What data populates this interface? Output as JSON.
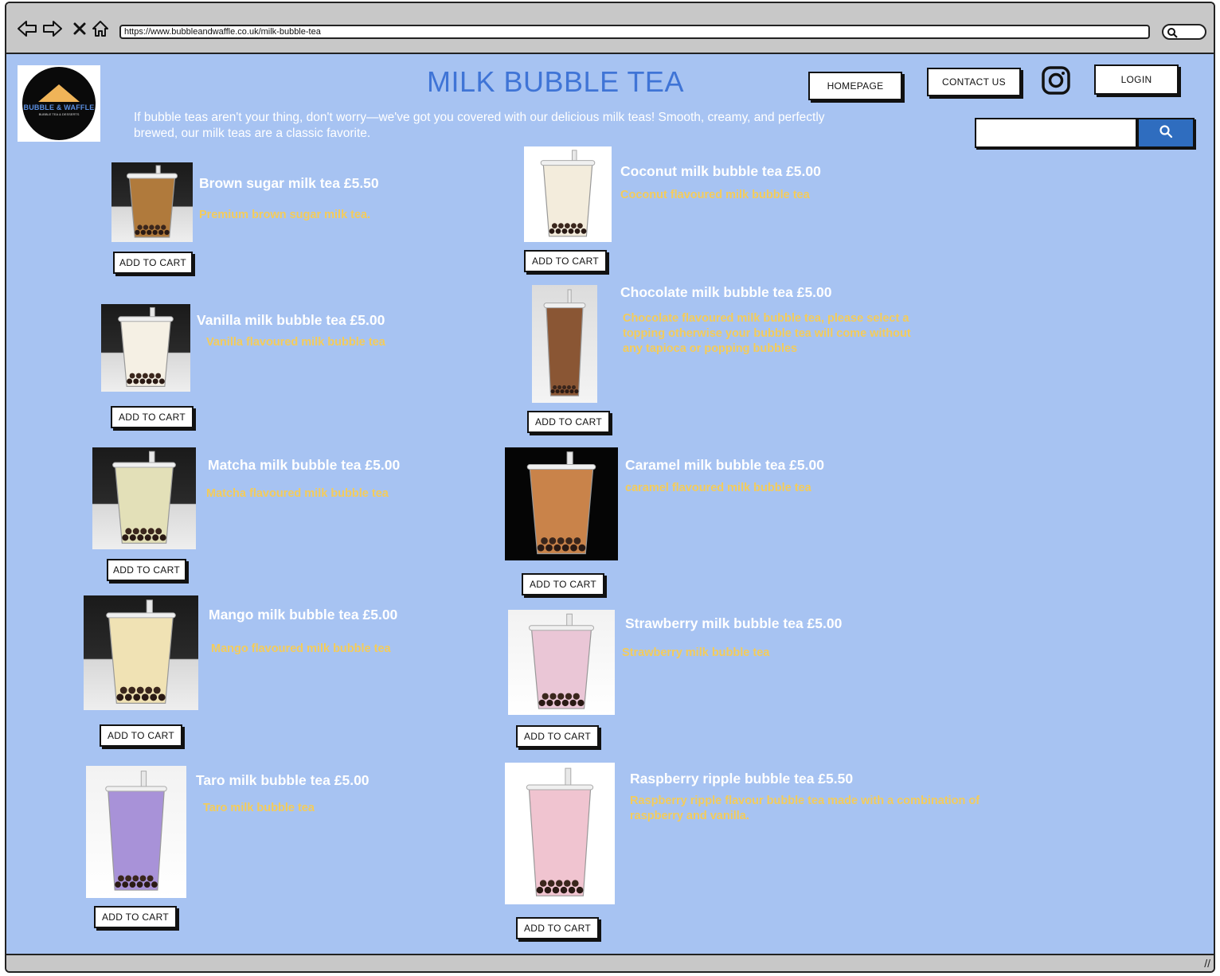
{
  "browser": {
    "url": "https://www.bubbleandwaffle.co.uk/milk-bubble-tea"
  },
  "header": {
    "title": "MILK BUBBLE TEA",
    "intro": "If bubble teas aren't your thing, don't worry—we've got you covered with our delicious milk teas! Smooth, creamy, and perfectly brewed, our milk teas are a classic favorite.",
    "homepage_label": "HOMEPAGE",
    "contact_label": "CONTACT US",
    "login_label": "LOGIN",
    "logo_text": "BUBBLE & WAFFLE",
    "logo_subtext": "BUBBLE TEA & DESSERTS"
  },
  "colors": {
    "page_background": "#a7c3f2",
    "title": "#3f74d6",
    "product_name": "#ffffff",
    "product_description": "#f4cc5a",
    "search_button": "#2f6dbf"
  },
  "cart_label": "ADD TO CART",
  "products": [
    {
      "name": "Brown sugar milk tea  £5.50",
      "desc": "Premium brown sugar milk tea.",
      "drink_color": "#b07a3c"
    },
    {
      "name": "Coconut milk bubble tea £5.00",
      "desc": "Coconut flavoured milk bubble tea",
      "drink_color": "#f3ecdc"
    },
    {
      "name": "Vanilla milk bubble tea £5.00",
      "desc": "Vanilla flavoured milk bubble tea",
      "drink_color": "#f5f0e4"
    },
    {
      "name": "Chocolate milk bubble tea £5.00",
      "desc": "Chocolate flavoured milk bubble tea, please select a topping otherwise your bubble tea will come without any tapioca or popping bubbles",
      "drink_color": "#8a5634"
    },
    {
      "name": "Matcha milk bubble tea  £5.00",
      "desc": "Matcha flavoured milk bubble tea",
      "drink_color": "#e3e0b8"
    },
    {
      "name": "Caramel milk bubble tea £5.00",
      "desc": "caramel flavoured milk bubble tea",
      "drink_color": "#c9834a"
    },
    {
      "name": "Mango milk bubble tea £5.00",
      "desc": "Mango flavoured milk bubble tea",
      "drink_color": "#f0e2b4"
    },
    {
      "name": "Strawberry milk bubble tea £5.00",
      "desc": "Strawberry milk bubble tea",
      "drink_color": "#eac6d6"
    },
    {
      "name": "Taro milk bubble tea £5.00",
      "desc": "Taro milk bubble tea",
      "drink_color": "#a892d8"
    },
    {
      "name": "Raspberry ripple bubble tea £5.50",
      "desc": "Raspberry ripple flavour bubble tea made with a combination of raspberry and vanilla.",
      "drink_color": "#f0c4d0"
    }
  ]
}
